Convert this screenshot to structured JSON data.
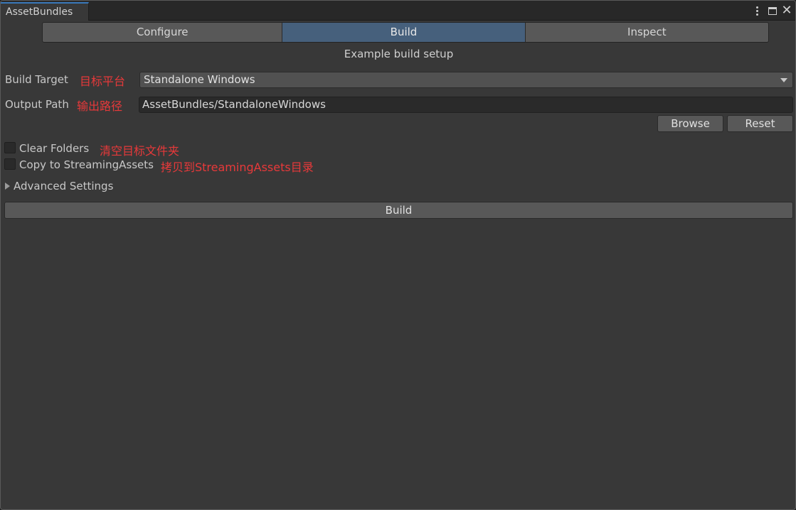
{
  "window": {
    "tab_title": "AssetBundles",
    "controls": {
      "menu_icon": "kebab-menu-icon",
      "maximize_icon": "maximize-icon",
      "close_icon": "close-icon",
      "close_glyph": "✕"
    }
  },
  "toolbar": {
    "tabs": [
      {
        "label": "Configure",
        "active": false
      },
      {
        "label": "Build",
        "active": true
      },
      {
        "label": "Inspect",
        "active": false
      }
    ]
  },
  "subtitle": "Example build setup",
  "fields": {
    "build_target": {
      "label": "Build Target",
      "note": "目标平台",
      "value": "Standalone Windows"
    },
    "output_path": {
      "label": "Output Path",
      "note": "输出路径",
      "value": "AssetBundles/StandaloneWindows"
    }
  },
  "buttons": {
    "browse": "Browse",
    "reset": "Reset",
    "build": "Build"
  },
  "options": {
    "clear_folders": {
      "label": "Clear Folders",
      "note": "清空目标文件夹",
      "checked": false
    },
    "copy_streaming": {
      "label": "Copy to StreamingAssets",
      "note": "拷贝到StreamingAssets目录",
      "checked": false
    }
  },
  "advanced": {
    "label": "Advanced Settings",
    "expanded": false
  },
  "colors": {
    "accent": "#3a79bb",
    "active_tab": "#46607c",
    "annotation": "#e8393a",
    "background": "#383838"
  }
}
